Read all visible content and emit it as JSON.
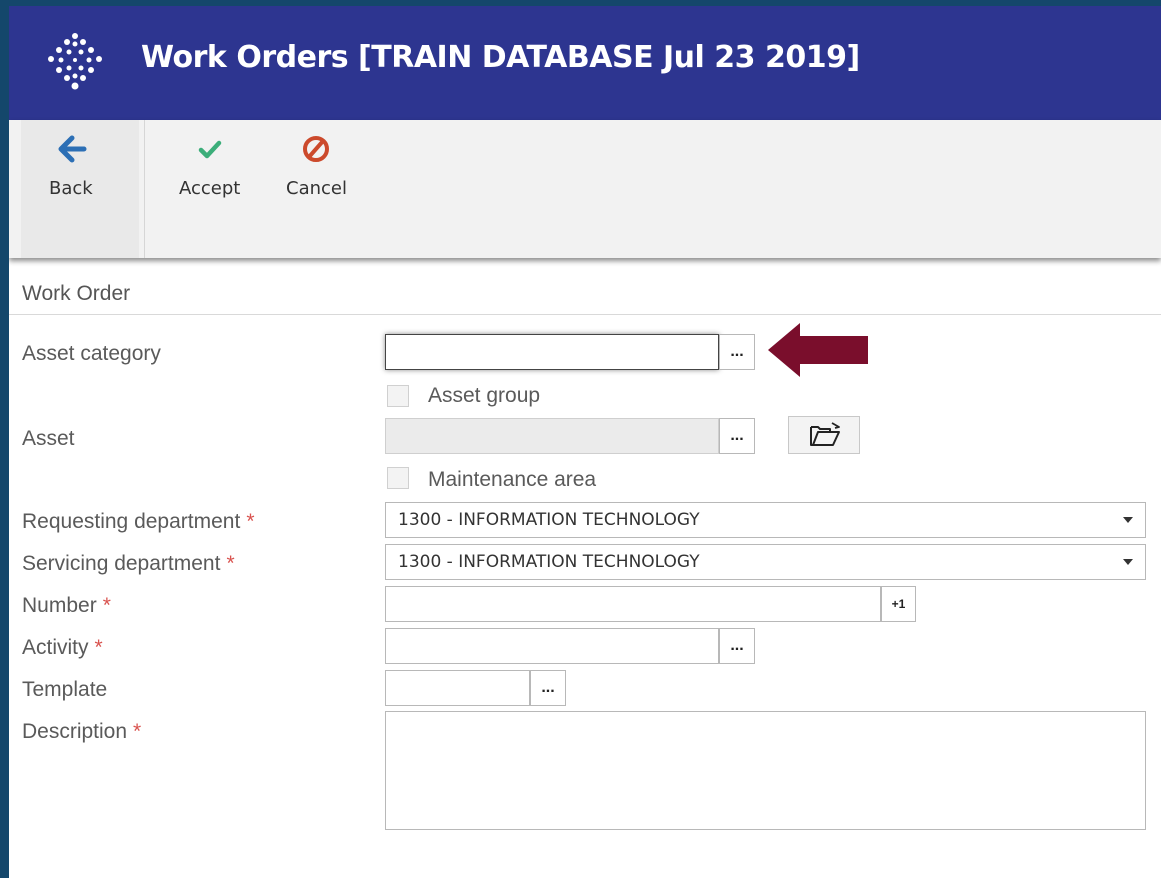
{
  "window": {
    "title": "Work Orders [TRAIN DATABASE Jul 23 2019]",
    "logo_icon": "dots-diamond-logo"
  },
  "toolbar": {
    "back_label": "Back",
    "accept_label": "Accept",
    "cancel_label": "Cancel"
  },
  "form": {
    "section_title": "Work Order",
    "asset_category": {
      "label": "Asset category",
      "value": "",
      "button": "..."
    },
    "asset_group": {
      "label": "Asset group",
      "checked": false
    },
    "asset": {
      "label": "Asset",
      "value": "",
      "button": "..."
    },
    "maintenance_area": {
      "label": "Maintenance area",
      "checked": false
    },
    "requesting_department": {
      "label": "Requesting department",
      "required": "*",
      "value": "1300 - INFORMATION TECHNOLOGY"
    },
    "servicing_department": {
      "label": "Servicing department",
      "required": "*",
      "value": "1300 - INFORMATION TECHNOLOGY"
    },
    "number": {
      "label": "Number",
      "required": "*",
      "value": "",
      "button": "+1"
    },
    "activity": {
      "label": "Activity",
      "required": "*",
      "value": "",
      "button": "..."
    },
    "template": {
      "label": "Template",
      "value": "",
      "button": "..."
    },
    "description": {
      "label": "Description",
      "required": "*",
      "value": ""
    }
  },
  "colors": {
    "title_bar": "#2d3590",
    "accept": "#3cae7a",
    "cancel": "#cc4a2c",
    "back": "#2c6fb5",
    "annotation_arrow": "#7a0e2c"
  }
}
